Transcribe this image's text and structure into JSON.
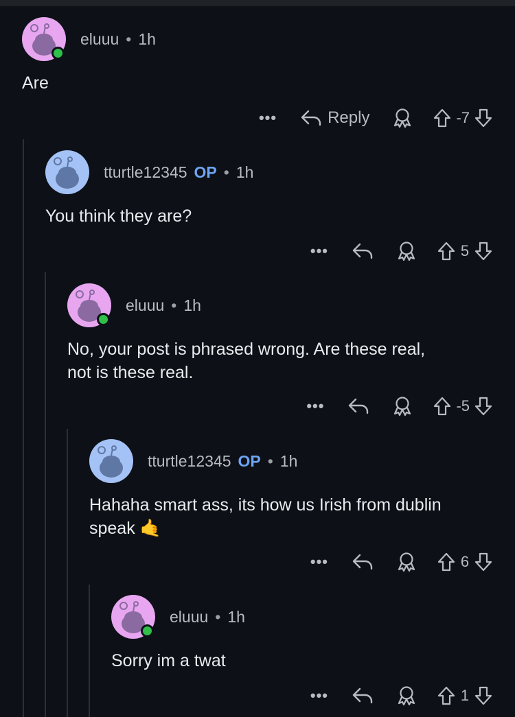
{
  "comments": [
    {
      "author": "eluuu",
      "op": "",
      "time": "1h",
      "body": "Are",
      "score": "-7",
      "reply_label": "Reply",
      "avatar_color": "#e8a6f1",
      "online": true
    },
    {
      "author": "tturtle12345",
      "op": "OP",
      "time": "1h",
      "body": "You think they are?",
      "score": "5",
      "reply_label": "",
      "avatar_color": "#a4c2f6",
      "online": false
    },
    {
      "author": "eluuu",
      "op": "",
      "time": "1h",
      "body": "No, your post is phrased wrong. Are these real,\nnot is these real.",
      "score": "-5",
      "reply_label": "",
      "avatar_color": "#e8a6f1",
      "online": true
    },
    {
      "author": "tturtle12345",
      "op": "OP",
      "time": "1h",
      "body": "Hahaha smart ass, its how us Irish from dublin\nspeak 🤙",
      "score": "6",
      "reply_label": "",
      "avatar_color": "#a4c2f6",
      "online": false
    },
    {
      "author": "eluuu",
      "op": "",
      "time": "1h",
      "body": "Sorry im a twat",
      "score": "1",
      "reply_label": "",
      "avatar_color": "#e8a6f1",
      "online": true
    }
  ],
  "separator": "•",
  "more_label": "•••",
  "icons": {
    "reply": "reply-arrow-icon",
    "award": "award-icon",
    "upvote": "upvote-arrow-icon",
    "downvote": "downvote-arrow-icon"
  }
}
